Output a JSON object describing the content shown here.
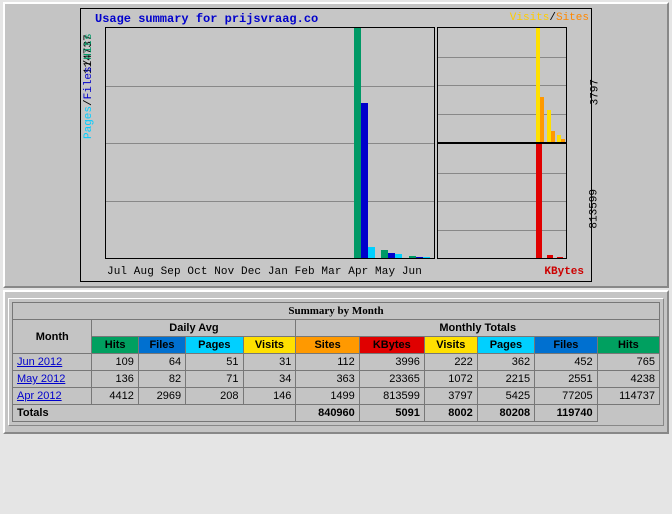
{
  "chart": {
    "title": "Usage summary for prijsvraag.co",
    "left_max_label": "114737",
    "right_top_max_label": "3797",
    "right_mid_max_label": "813599",
    "left_axis_parts": [
      {
        "text": "Pages",
        "cls": "c-cyan"
      },
      {
        "text": "/",
        "cls": ""
      },
      {
        "text": "Files",
        "cls": "c-blue"
      },
      {
        "text": "/",
        "cls": ""
      },
      {
        "text": "Hits",
        "cls": "c-green"
      }
    ],
    "right_top_parts": [
      {
        "text": "Visits",
        "cls": "c-yellow"
      },
      {
        "text": "/",
        "cls": ""
      },
      {
        "text": "Sites",
        "cls": "c-orange"
      }
    ],
    "right_bottom_label": "KBytes",
    "months_axis": "Jul Aug Sep Oct Nov Dec Jan Feb Mar Apr May Jun"
  },
  "chart_data": {
    "type": "bar",
    "categories": [
      "Jul",
      "Aug",
      "Sep",
      "Oct",
      "Nov",
      "Dec",
      "Jan",
      "Feb",
      "Mar",
      "Apr",
      "May",
      "Jun"
    ],
    "panels": [
      {
        "name": "left",
        "ylim": [
          0,
          114737
        ],
        "series": [
          {
            "name": "Hits",
            "color": "#009966",
            "values": [
              0,
              0,
              0,
              0,
              0,
              0,
              0,
              0,
              0,
              114737,
              4238,
              765
            ]
          },
          {
            "name": "Files",
            "color": "#0000cc",
            "values": [
              0,
              0,
              0,
              0,
              0,
              0,
              0,
              0,
              0,
              77205,
              2551,
              452
            ]
          },
          {
            "name": "Pages",
            "color": "#00d0ff",
            "values": [
              0,
              0,
              0,
              0,
              0,
              0,
              0,
              0,
              0,
              5425,
              2215,
              362
            ]
          }
        ]
      },
      {
        "name": "top-right",
        "ylim": [
          0,
          3797
        ],
        "series": [
          {
            "name": "Visits",
            "color": "#ffe000",
            "values": [
              0,
              0,
              0,
              0,
              0,
              0,
              0,
              0,
              0,
              3797,
              1072,
              222
            ]
          },
          {
            "name": "Sites",
            "color": "#ff9900",
            "values": [
              0,
              0,
              0,
              0,
              0,
              0,
              0,
              0,
              0,
              1499,
              363,
              112
            ]
          }
        ]
      },
      {
        "name": "bottom-right",
        "ylim": [
          0,
          813599
        ],
        "series": [
          {
            "name": "KBytes",
            "color": "#e00000",
            "values": [
              0,
              0,
              0,
              0,
              0,
              0,
              0,
              0,
              0,
              813599,
              23365,
              3996
            ]
          }
        ]
      }
    ]
  },
  "table": {
    "title": "Summary by Month",
    "col_groups": {
      "month": "Month",
      "daily": "Daily Avg",
      "monthly": "Monthly Totals"
    },
    "cols": {
      "hits": "Hits",
      "files": "Files",
      "pages": "Pages",
      "visits": "Visits",
      "sites": "Sites",
      "kbytes": "KBytes"
    },
    "rows": [
      {
        "month": "Jun 2012",
        "d_hits": 109,
        "d_files": 64,
        "d_pages": 51,
        "d_visits": 31,
        "m_sites": 112,
        "m_kbytes": 3996,
        "m_visits": 222,
        "m_pages": 362,
        "m_files": 452,
        "m_hits": 765
      },
      {
        "month": "May 2012",
        "d_hits": 136,
        "d_files": 82,
        "d_pages": 71,
        "d_visits": 34,
        "m_sites": 363,
        "m_kbytes": 23365,
        "m_visits": 1072,
        "m_pages": 2215,
        "m_files": 2551,
        "m_hits": 4238
      },
      {
        "month": "Apr 2012",
        "d_hits": 4412,
        "d_files": 2969,
        "d_pages": 208,
        "d_visits": 146,
        "m_sites": 1499,
        "m_kbytes": 813599,
        "m_visits": 3797,
        "m_pages": 5425,
        "m_files": 77205,
        "m_hits": 114737
      }
    ],
    "totals": {
      "label": "Totals",
      "kbytes": 840960,
      "visits": 5091,
      "pages": 8002,
      "files": 80208,
      "hits": 119740
    }
  }
}
